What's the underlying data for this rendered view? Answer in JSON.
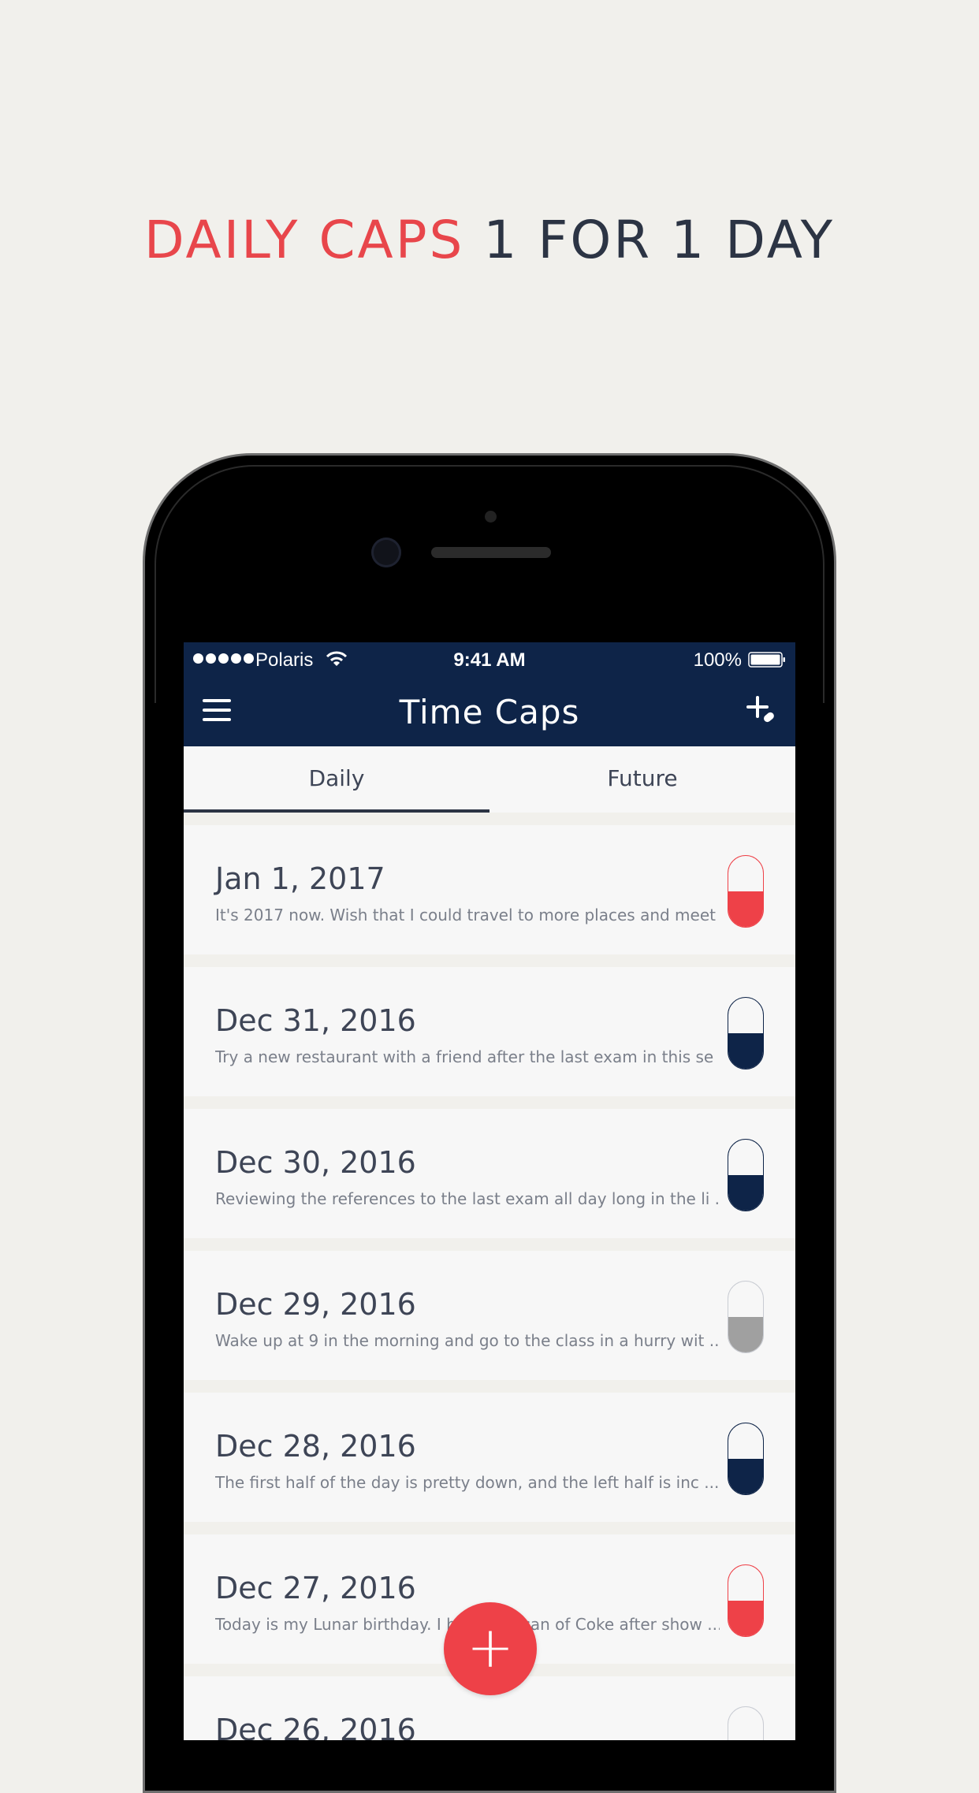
{
  "headline": {
    "accent": "DAILY CAPS",
    "rest": "1 FOR 1 DAY"
  },
  "status_bar": {
    "carrier": "Polaris",
    "time": "9:41 AM",
    "battery": "100%"
  },
  "nav": {
    "title": "Time Caps"
  },
  "tabs": [
    {
      "label": "Daily",
      "active": true
    },
    {
      "label": "Future",
      "active": false
    }
  ],
  "entries": [
    {
      "date": "Jan 1, 2017",
      "excerpt": "It's 2017 now. Wish that I could travel to more places and meet ...",
      "cap_color": "#ee4148",
      "fill_level": 0.5
    },
    {
      "date": "Dec 31, 2016",
      "excerpt": "Try a new restaurant with a friend after the last exam in this se ...",
      "cap_color": "#0e2448",
      "fill_level": 0.5
    },
    {
      "date": "Dec 30, 2016",
      "excerpt": "Reviewing the references to the last exam all day long in the li ...",
      "cap_color": "#0e2448",
      "fill_level": 0.5
    },
    {
      "date": "Dec 29, 2016",
      "excerpt": "Wake up at 9 in the morning and go to the class in a hurry wit ...",
      "cap_color": "#a0a0a0",
      "fill_level": 0.5
    },
    {
      "date": "Dec 28, 2016",
      "excerpt": "The first half of the day is pretty down, and the left half is inc ...",
      "cap_color": "#0e2448",
      "fill_level": 0.5
    },
    {
      "date": "Dec 27, 2016",
      "excerpt": "Today is my Lunar birthday. I bought a can of Coke after show ...",
      "cap_color": "#ee4148",
      "fill_level": 0.5
    },
    {
      "date": "Dec 26, 2016",
      "excerpt": "",
      "cap_color": "#f7f7f7",
      "fill_level": 0
    }
  ],
  "fab": {
    "label": "+"
  },
  "icons": {
    "menu": "menu-icon",
    "add_capsule": "add-capsule-icon",
    "wifi": "wifi-icon",
    "battery": "battery-icon"
  }
}
